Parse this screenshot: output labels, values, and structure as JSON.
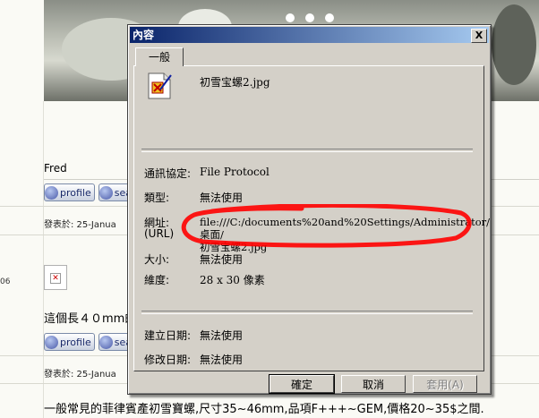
{
  "page": {
    "author": "Fred",
    "profile_label": "profile",
    "search_label": "sea",
    "posted_1": "發表於: 25-Janua",
    "posted_2": "發表於: 25-Janua",
    "side_number": "06",
    "broken_image_glyph": "✕",
    "line_1": "這個長４０mm的",
    "line_2": "一般常見的菲律賓產初雪寶螺,尺寸35~46mm,品項F+++~GEM,價格20~35$之間."
  },
  "dialog": {
    "title": "內容",
    "close_label": "X",
    "tab_general": "一般",
    "file_name": "初雪宝螺2.jpg",
    "protocol_label": "通訊協定:",
    "protocol_value": "File Protocol",
    "type_label": "類型:",
    "type_value": "無法使用",
    "address_label": "網址:",
    "address_label_sub": "(URL)",
    "address_value_1": "file:///C:/documents%20and%20Settings/Administrator/桌面/",
    "address_value_2": "初雪宝螺2.jpg",
    "size_label": "大小:",
    "size_value": "無法使用",
    "dimension_label": "維度:",
    "dimension_value": "28 x 30 像素",
    "created_label": "建立日期:",
    "created_value": "無法使用",
    "modified_label": "修改日期:",
    "modified_value": "無法使用",
    "ok_label": "確定",
    "cancel_label": "取消",
    "apply_label": "套用(A)"
  },
  "icons": {
    "file": "image-file-icon",
    "profile": "profile-icon",
    "search": "search-icon"
  },
  "colors": {
    "title_bar_start": "#0a246a",
    "title_bar_end": "#a6caf0",
    "dialog_face": "#d4d0c8",
    "highlight_scribble": "#ff0000"
  }
}
